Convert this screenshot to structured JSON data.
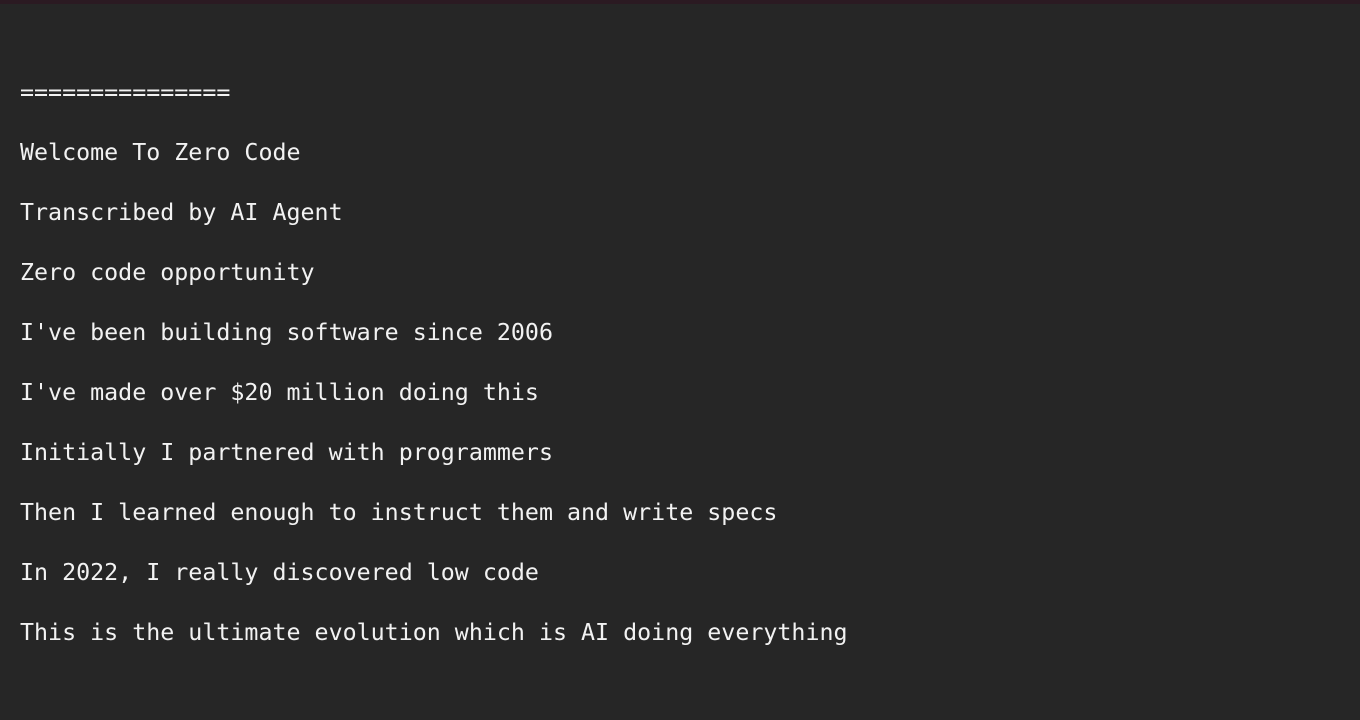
{
  "terminal": {
    "background_color": "#262626",
    "text_color": "#f2f2f2",
    "top_strip_color": "#2b1a22",
    "lines": [
      {
        "id": "divider",
        "text": "==============="
      },
      {
        "id": "title",
        "text": "Welcome To Zero Code"
      },
      {
        "id": "attribution",
        "text": "Transcribed by AI Agent"
      },
      {
        "id": "topic",
        "text": "Zero code opportunity"
      },
      {
        "id": "since-2006",
        "text": "I've been building software since 2006"
      },
      {
        "id": "earnings",
        "text": "I've made over $20 million doing this"
      },
      {
        "id": "partnered",
        "text": "Initially I partnered with programmers"
      },
      {
        "id": "specs",
        "text": "Then I learned enough to instruct them and write specs"
      },
      {
        "id": "low-code",
        "text": "In 2022, I really discovered low code"
      },
      {
        "id": "evolution",
        "text": "This is the ultimate evolution which is AI doing everything"
      }
    ]
  }
}
